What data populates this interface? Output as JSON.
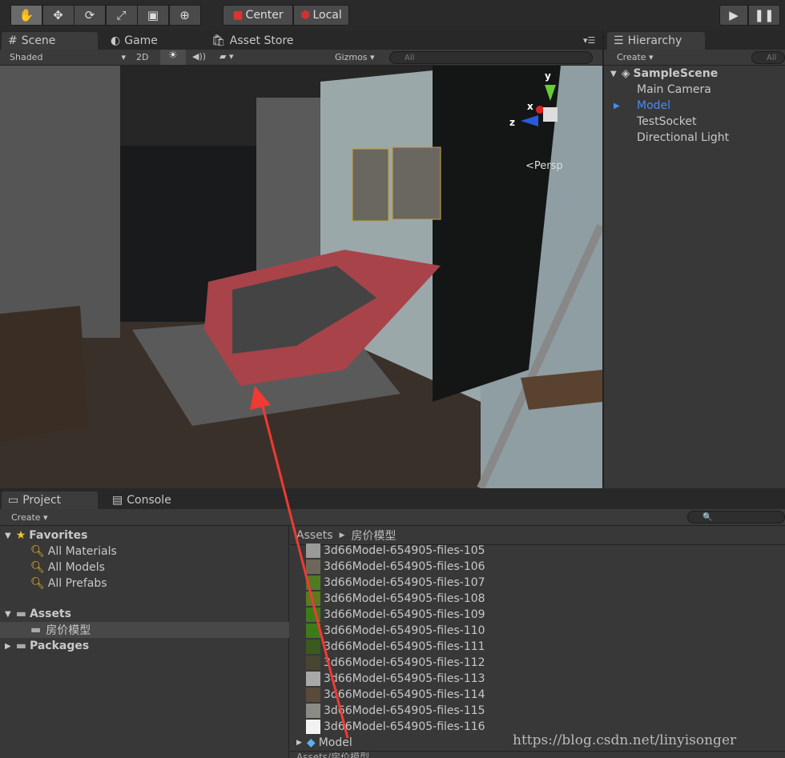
{
  "toolbar": {
    "tools": [
      "hand-icon",
      "move-icon",
      "rotate-icon",
      "scale-icon",
      "rect-icon",
      "transform-icon"
    ],
    "pivot": "Center",
    "space": "Local"
  },
  "scene_tabs": {
    "scene": "Scene",
    "game": "Game",
    "asset_store": "Asset Store"
  },
  "scene_bar": {
    "shading": "Shaded",
    "mode_2d": "2D",
    "gizmos": "Gizmos",
    "search_placeholder": "All"
  },
  "gizmo": {
    "y": "y",
    "x": "x",
    "z": "z",
    "persp": "<Persp"
  },
  "hierarchy": {
    "tab": "Hierarchy",
    "create": "Create",
    "search_placeholder": "All",
    "scene": "SampleScene",
    "items": [
      {
        "label": "Main Camera",
        "selected": false
      },
      {
        "label": "Model",
        "selected": true
      },
      {
        "label": "TestSocket",
        "selected": false
      },
      {
        "label": "Directional Light",
        "selected": false
      }
    ]
  },
  "project": {
    "tab": "Project",
    "console_tab": "Console",
    "create": "Create",
    "favorites": {
      "label": "Favorites",
      "items": [
        "All Materials",
        "All Models",
        "All Prefabs"
      ]
    },
    "assets": {
      "label": "Assets",
      "children": [
        "房价模型"
      ]
    },
    "packages": "Packages",
    "breadcrumb": [
      "Assets",
      "房价模型"
    ],
    "files": [
      {
        "name": "3d66Model-654905-files-105",
        "color": "#9a9a98"
      },
      {
        "name": "3d66Model-654905-files-106",
        "color": "#6e665a"
      },
      {
        "name": "3d66Model-654905-files-107",
        "color": "#4f7a22"
      },
      {
        "name": "3d66Model-654905-files-108",
        "color": "#5a7a1e"
      },
      {
        "name": "3d66Model-654905-files-109",
        "color": "#3f7a1a"
      },
      {
        "name": "3d66Model-654905-files-110",
        "color": "#3f7a1a"
      },
      {
        "name": "3d66Model-654905-files-111",
        "color": "#3a5a20"
      },
      {
        "name": "3d66Model-654905-files-112",
        "color": "#4a4432"
      },
      {
        "name": "3d66Model-654905-files-113",
        "color": "#a8a8a8"
      },
      {
        "name": "3d66Model-654905-files-114",
        "color": "#5a4a3a"
      },
      {
        "name": "3d66Model-654905-files-115",
        "color": "#8a8a86"
      },
      {
        "name": "3d66Model-654905-files-116",
        "color": "#f2f2f2"
      }
    ],
    "model": "Model",
    "status_path": "Assets/房价模型"
  },
  "watermark": "https://blog.csdn.net/linyisonger",
  "colors": {
    "selected": "#4a8cf0",
    "annotation_arrow": "#f03a32"
  }
}
